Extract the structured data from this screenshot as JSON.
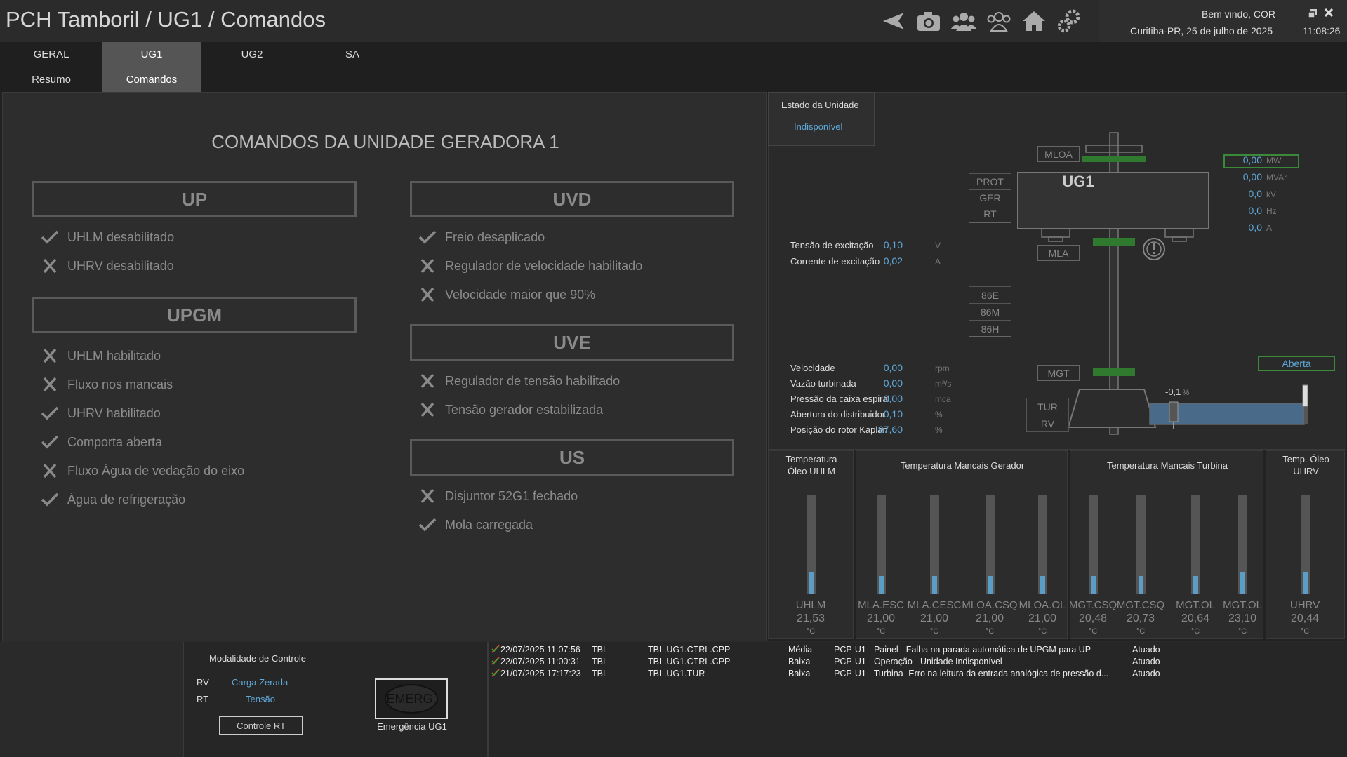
{
  "header": {
    "title": "PCH Tamboril / UG1 / Comandos",
    "welcome": "Bem vindo, COR",
    "location_date": "Curitiba-PR, 25 de julho de 2025",
    "time": "11:08:26",
    "icons": [
      "back-icon",
      "camera-icon",
      "group-icon",
      "users-outline-icon",
      "home-icon",
      "settings-icon"
    ]
  },
  "tabs": {
    "primary": [
      "GERAL",
      "UG1",
      "UG2",
      "SA"
    ],
    "secondary": [
      "Resumo",
      "Comandos"
    ]
  },
  "commands": {
    "title": "COMANDOS DA UNIDADE GERADORA 1",
    "groups": [
      {
        "name": "UP",
        "items": [
          {
            "label": "UHLM desabilitado",
            "ok": true
          },
          {
            "label": "UHRV desabilitado",
            "ok": false
          }
        ]
      },
      {
        "name": "UPGM",
        "items": [
          {
            "label": "UHLM habilitado",
            "ok": false
          },
          {
            "label": "Fluxo nos mancais",
            "ok": false
          },
          {
            "label": "UHRV habilitado",
            "ok": true
          },
          {
            "label": "Comporta aberta",
            "ok": true
          },
          {
            "label": "Fluxo Água de vedação do eixo",
            "ok": false
          },
          {
            "label": "Água de refrigeração",
            "ok": true
          }
        ]
      },
      {
        "name": "UVD",
        "items": [
          {
            "label": "Freio desaplicado",
            "ok": true
          },
          {
            "label": "Regulador de velocidade habilitado",
            "ok": false
          },
          {
            "label": "Velocidade maior que 90%",
            "ok": false
          }
        ]
      },
      {
        "name": "UVE",
        "items": [
          {
            "label": "Regulador de tensão habilitado",
            "ok": false
          },
          {
            "label": "Tensão gerador estabilizada",
            "ok": false
          }
        ]
      },
      {
        "name": "US",
        "items": [
          {
            "label": "Disjuntor 52G1 fechado",
            "ok": false
          },
          {
            "label": "Mola carregada",
            "ok": true
          }
        ]
      }
    ]
  },
  "unit": {
    "state_label": "Estado da Unidade",
    "state_value": "Indisponível",
    "name": "UG1",
    "tags": {
      "mloa": "MLOA",
      "mla": "MLA",
      "mgt": "MGT",
      "prot": "PROT",
      "ger": "GER",
      "rt": "RT",
      "e86": "86E",
      "m86": "86M",
      "h86": "86H",
      "tur": "TUR",
      "rv": "RV"
    },
    "excitation": [
      {
        "label": "Tensão de excitação",
        "value": "-0,10",
        "unit": "V"
      },
      {
        "label": "Corrente de excitação",
        "value": "0,02",
        "unit": "A"
      }
    ],
    "electrical": [
      {
        "value": "0,00",
        "unit": "MW"
      },
      {
        "value": "0,00",
        "unit": "MVAr"
      },
      {
        "value": "0,0",
        "unit": "kV"
      },
      {
        "value": "0,0",
        "unit": "Hz"
      },
      {
        "value": "0,0",
        "unit": "A"
      }
    ],
    "hydraulic": [
      {
        "label": "Velocidade",
        "value": "0,00",
        "unit": "rpm"
      },
      {
        "label": "Vazão turbinada",
        "value": "0,00",
        "unit": "m³/s"
      },
      {
        "label": "Pressão da caixa espiral",
        "value": "0,00",
        "unit": "mca"
      },
      {
        "label": "Abertura do distribuidor",
        "value": "-0,10",
        "unit": "%"
      },
      {
        "label": "Posição do rotor Kaplan",
        "value": "97,60",
        "unit": "%"
      }
    ],
    "gate_status": "Aberta",
    "gate_value": "-0,1",
    "gate_unit": "%"
  },
  "temperatures": {
    "panels": [
      {
        "title": "Temperatura Óleo UHLM",
        "sensors": [
          {
            "name": "UHLM",
            "value": "21,53",
            "unit": "°C",
            "level": 0.22
          }
        ]
      },
      {
        "title": "Temperatura Mancais Gerador",
        "sensors": [
          {
            "name": "MLA.ESC",
            "value": "21,00",
            "unit": "°C",
            "level": 0.18
          },
          {
            "name": "MLA.CESC",
            "value": "21,00",
            "unit": "°C",
            "level": 0.18
          },
          {
            "name": "MLOA.CSQ",
            "value": "21,00",
            "unit": "°C",
            "level": 0.18
          },
          {
            "name": "MLOA.OL",
            "value": "21,00",
            "unit": "°C",
            "level": 0.18
          }
        ]
      },
      {
        "title": "Temperatura Mancais Turbina",
        "sensors": [
          {
            "name": "MGT.CSQ",
            "value": "20,48",
            "unit": "°C",
            "level": 0.18
          },
          {
            "name": "MGT.CSQ",
            "value": "20,73",
            "unit": "°C",
            "level": 0.18
          },
          {
            "name": "MGT.OL",
            "value": "20,64",
            "unit": "°C",
            "level": 0.18
          },
          {
            "name": "MGT.OL",
            "value": "23,10",
            "unit": "°C",
            "level": 0.22
          }
        ]
      },
      {
        "title": "Temp. Óleo UHRV",
        "sensors": [
          {
            "name": "UHRV",
            "value": "20,44",
            "unit": "°C",
            "level": 0.22
          }
        ]
      }
    ]
  },
  "control": {
    "title": "Modalidade de Controle",
    "rows": [
      {
        "key": "RV",
        "value": "Carga Zerada"
      },
      {
        "key": "RT",
        "value": "Tensão"
      }
    ],
    "button": "Controle RT"
  },
  "emergency": {
    "button": "EMERG.",
    "label": "Emergência UG1"
  },
  "alarms": [
    {
      "datetime": "22/07/2025 11:07:56",
      "source": "TBL",
      "tag": "TBL.UG1.CTRL.CPP",
      "priority": "Média",
      "message": "PCP-U1 - Painel - Falha na parada automática de UPGM para UP",
      "status": "Atuado"
    },
    {
      "datetime": "22/07/2025 11:00:31",
      "source": "TBL",
      "tag": "TBL.UG1.CTRL.CPP",
      "priority": "Baixa",
      "message": "PCP-U1 - Operação - Unidade Indisponível",
      "status": "Atuado"
    },
    {
      "datetime": "21/07/2025 17:17:23",
      "source": "TBL",
      "tag": "TBL.UG1.TUR",
      "priority": "Baixa",
      "message": "PCP-U1 - Turbina- Erro na leitura da entrada analógica de pressão d...",
      "status": "Atuado"
    }
  ]
}
